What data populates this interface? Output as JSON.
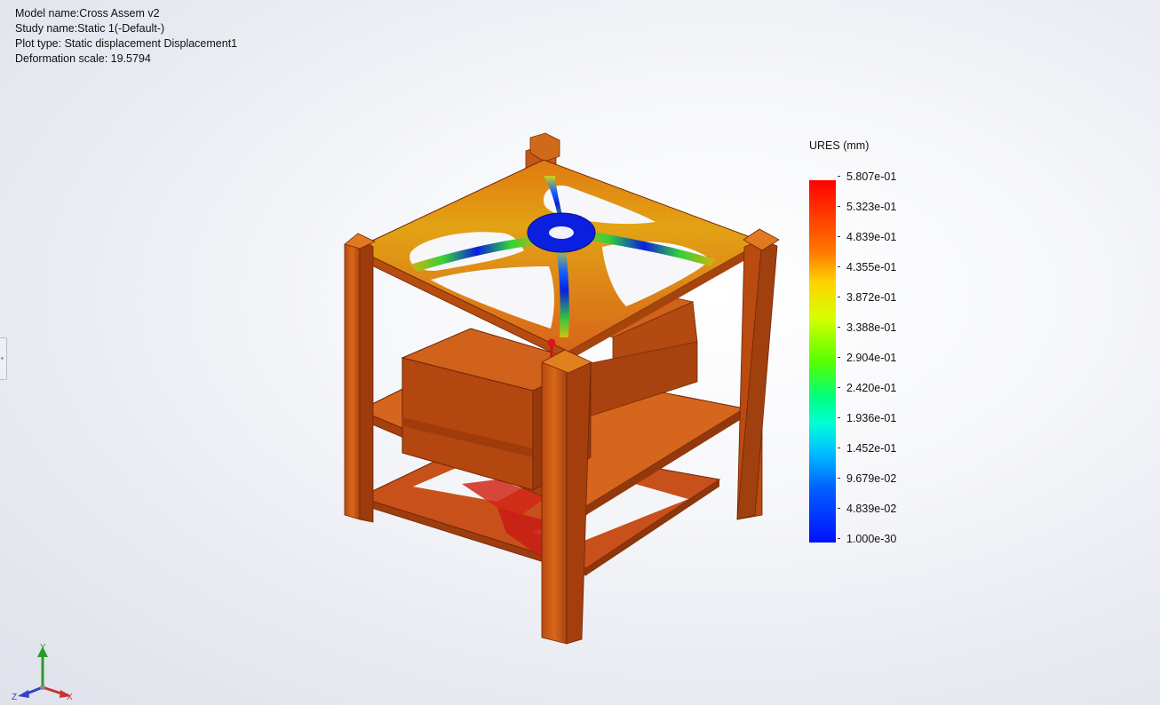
{
  "header": {
    "model_name": "Model name:Cross Assem v2",
    "study_name": "Study name:Static 1(-Default-)",
    "plot_type": "Plot type: Static displacement Displacement1",
    "deformation_scale": "Deformation scale: 19.5794"
  },
  "legend": {
    "title": "URES (mm)",
    "labels": [
      "5.807e-01",
      "5.323e-01",
      "4.839e-01",
      "4.355e-01",
      "3.872e-01",
      "3.388e-01",
      "2.904e-01",
      "2.420e-01",
      "1.936e-01",
      "1.452e-01",
      "9.679e-02",
      "4.839e-02",
      "1.000e-30"
    ],
    "colors": {
      "max": "#ff0000",
      "high": "#ff7a00",
      "mid_high": "#ffd200",
      "mid": "#57ff00",
      "mid_low": "#00ffd5",
      "low": "#0060ff",
      "min": "#0010ff"
    }
  },
  "triad": {
    "x_label": "X",
    "y_label": "Y",
    "z_label": "Z"
  },
  "model": {
    "icons": [
      "cubesat-model",
      "fixture-pin-icon"
    ],
    "colors": {
      "frame": "#d0601a",
      "frame_dark": "#9a3c0c",
      "plate": "#cf5a1c",
      "hub": "#0a1fe0"
    }
  }
}
